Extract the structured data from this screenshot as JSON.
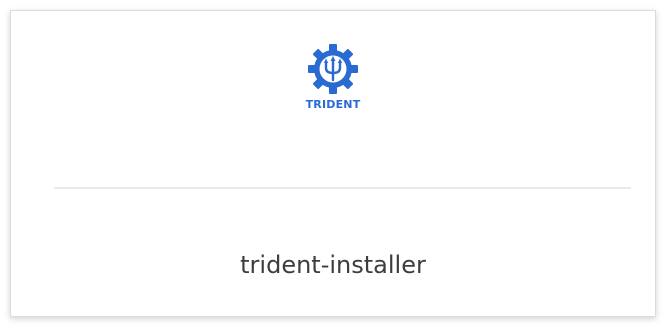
{
  "tile": {
    "logo": {
      "wordmark": "TRIDENT",
      "icon": "trident-gear-icon",
      "color": "#2a6ad3"
    },
    "name": "trident-installer"
  }
}
